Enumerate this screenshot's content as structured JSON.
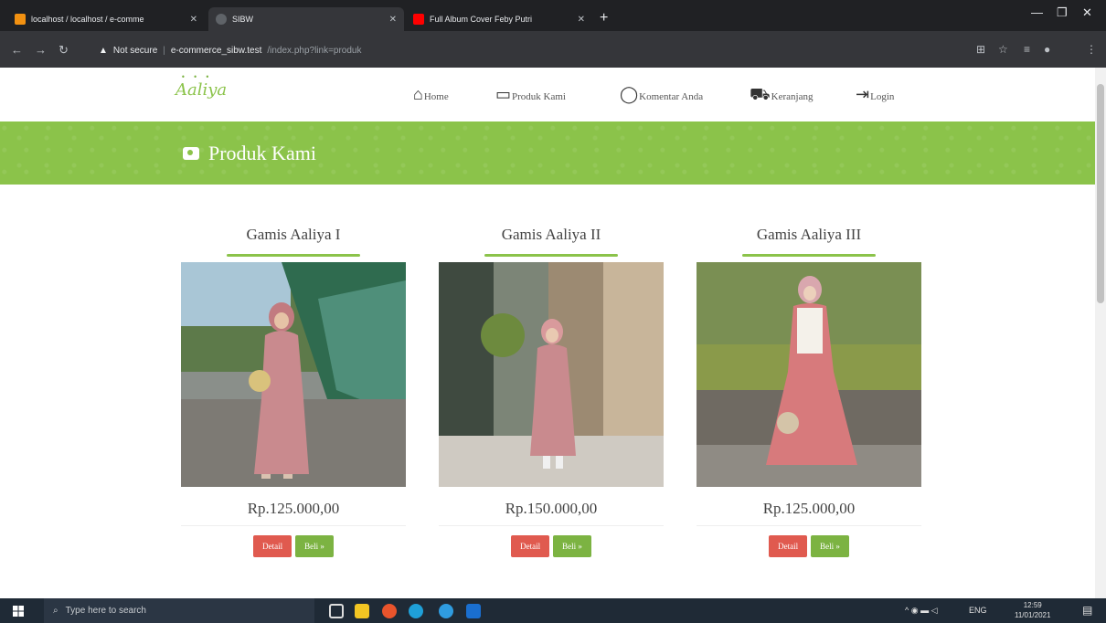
{
  "browser": {
    "tabs": [
      {
        "title": "localhost / localhost / e-comme",
        "favicon_color": "#f29111",
        "active": false
      },
      {
        "title": "SIBW",
        "favicon_color": "#5f6368",
        "active": true
      },
      {
        "title": "Full Album Cover Feby Putri",
        "favicon_color": "#ff0000",
        "active": false
      }
    ],
    "new_tab": "+",
    "security_label": "Not secure",
    "url_host": "e-commerce_sibw.test",
    "url_path": "/index.php?link=produk"
  },
  "site": {
    "logo_text": "Aaliya",
    "nav": [
      {
        "label": "Home",
        "icon": "home-icon",
        "glyph": "⌂"
      },
      {
        "label": "Produk Kami",
        "icon": "box-icon",
        "glyph": "▭"
      },
      {
        "label": "Komentar Anda",
        "icon": "comment-icon",
        "glyph": "◯"
      },
      {
        "label": "Keranjang",
        "icon": "cart-icon",
        "glyph": "⛟"
      },
      {
        "label": "Login",
        "icon": "login-icon",
        "glyph": "⇥"
      }
    ],
    "banner_title": "Produk Kami",
    "products": [
      {
        "name": "Gamis Aaliya I",
        "price": "Rp.125.000,00",
        "detail_label": "Detail",
        "buy_label": "Beli »"
      },
      {
        "name": "Gamis Aaliya II",
        "price": "Rp.150.000,00",
        "detail_label": "Detail",
        "buy_label": "Beli »"
      },
      {
        "name": "Gamis Aaliya III",
        "price": "Rp.125.000,00",
        "detail_label": "Detail",
        "buy_label": "Beli »"
      }
    ],
    "accent_color": "#8bc34a"
  },
  "taskbar": {
    "search_placeholder": "Type here to search",
    "language": "ENG",
    "time": "12:59",
    "date": "11/01/2021"
  }
}
